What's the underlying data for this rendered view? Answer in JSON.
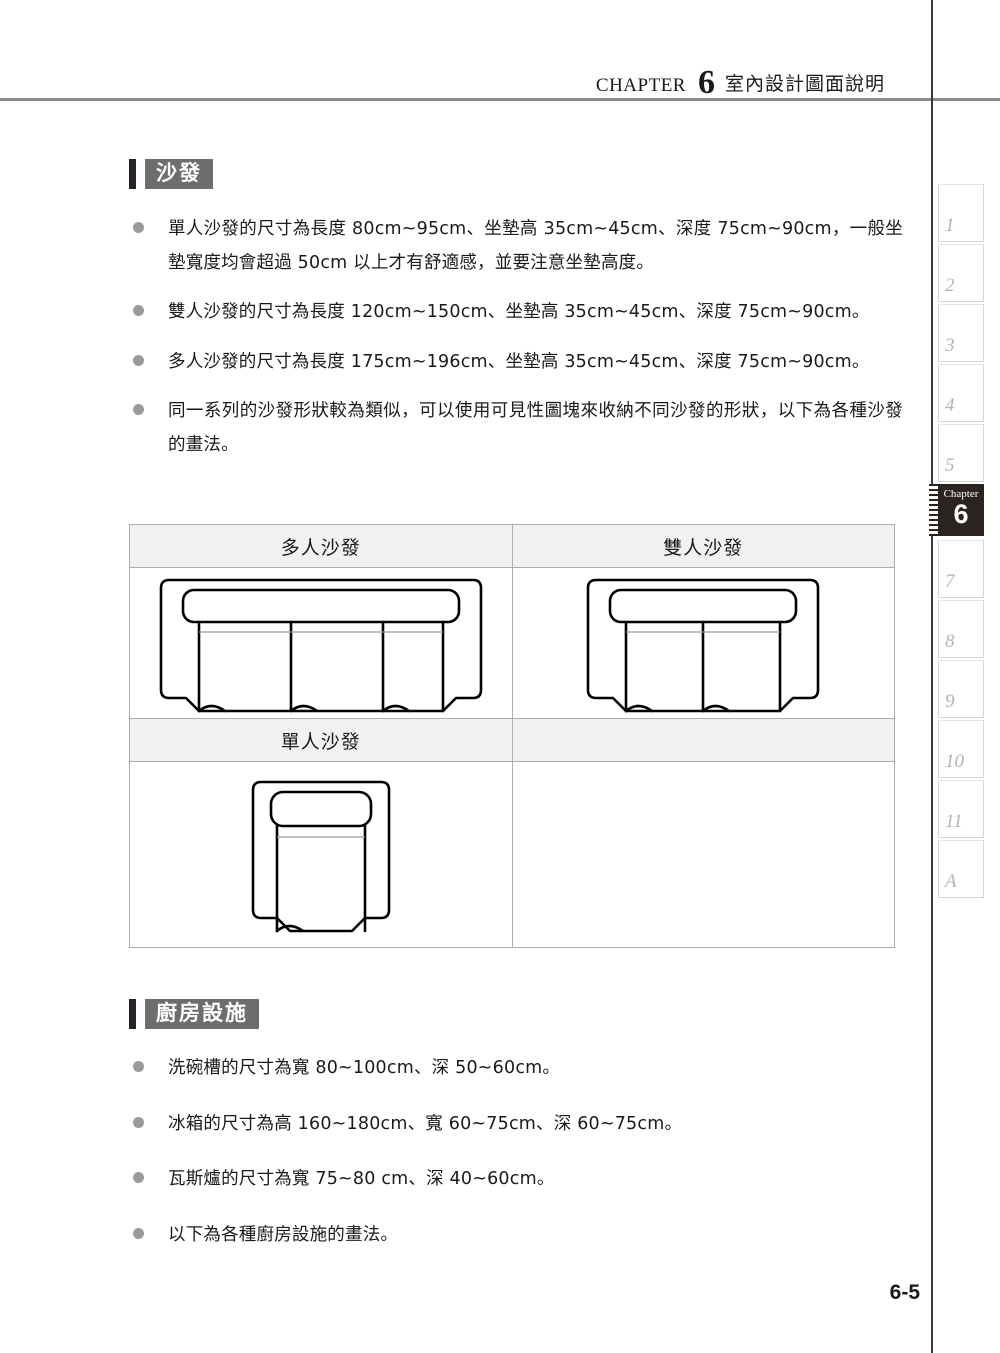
{
  "header": {
    "chapter_word": "CHAPTER",
    "chapter_number": "6",
    "title": "室內設計圖面說明"
  },
  "tab_rail": {
    "items": [
      {
        "label": "1",
        "active": false
      },
      {
        "label": "2",
        "active": false
      },
      {
        "label": "3",
        "active": false
      },
      {
        "label": "4",
        "active": false
      },
      {
        "label": "5",
        "active": false
      },
      {
        "label": "6",
        "active": true,
        "chapter_word": "Chapter"
      },
      {
        "label": "7",
        "active": false
      },
      {
        "label": "8",
        "active": false
      },
      {
        "label": "9",
        "active": false
      },
      {
        "label": "10",
        "active": false
      },
      {
        "label": "11",
        "active": false
      },
      {
        "label": "A",
        "active": false
      }
    ]
  },
  "sections": {
    "sofa": {
      "heading": "沙發",
      "bullets": [
        "單人沙發的尺寸為長度 80cm~95cm、坐墊高 35cm~45cm、深度 75cm~90cm，一般坐墊寬度均會超過 50cm 以上才有舒適感，並要注意坐墊高度。",
        "雙人沙發的尺寸為長度 120cm~150cm、坐墊高 35cm~45cm、深度 75cm~90cm。",
        "多人沙發的尺寸為長度 175cm~196cm、坐墊高 35cm~45cm、深度 75cm~90cm。",
        "同一系列的沙發形狀較為類似，可以使用可見性圖塊來收納不同沙發的形狀，以下為各種沙發的畫法。"
      ],
      "table": {
        "rows": [
          {
            "headers": [
              "多人沙發",
              "雙人沙發"
            ],
            "figures": [
              "sofa-three-seat-drawing",
              "sofa-two-seat-drawing"
            ]
          },
          {
            "headers": [
              "單人沙發",
              ""
            ],
            "figures": [
              "sofa-one-seat-drawing",
              ""
            ]
          }
        ]
      }
    },
    "kitchen": {
      "heading": "廚房設施",
      "bullets": [
        "洗碗槽的尺寸為寬 80~100cm、深 50~60cm。",
        "冰箱的尺寸為高 160~180cm、寬 60~75cm、深 60~75cm。",
        "瓦斯爐的尺寸為寬 75~80 cm、深 40~60cm。",
        "以下為各種廚房設施的畫法。"
      ]
    }
  },
  "page_number": "6-5",
  "colors": {
    "heading_box": "#6e6c6e",
    "heading_bar": "#2b2320",
    "rule": "#8c8a8c",
    "bullet": "#9a9a9a",
    "table_header_fill": "#f1f1f1",
    "table_border": "#adadad",
    "active_tab": "#2b2320",
    "inactive_tab_text": "#b4b4b4"
  }
}
